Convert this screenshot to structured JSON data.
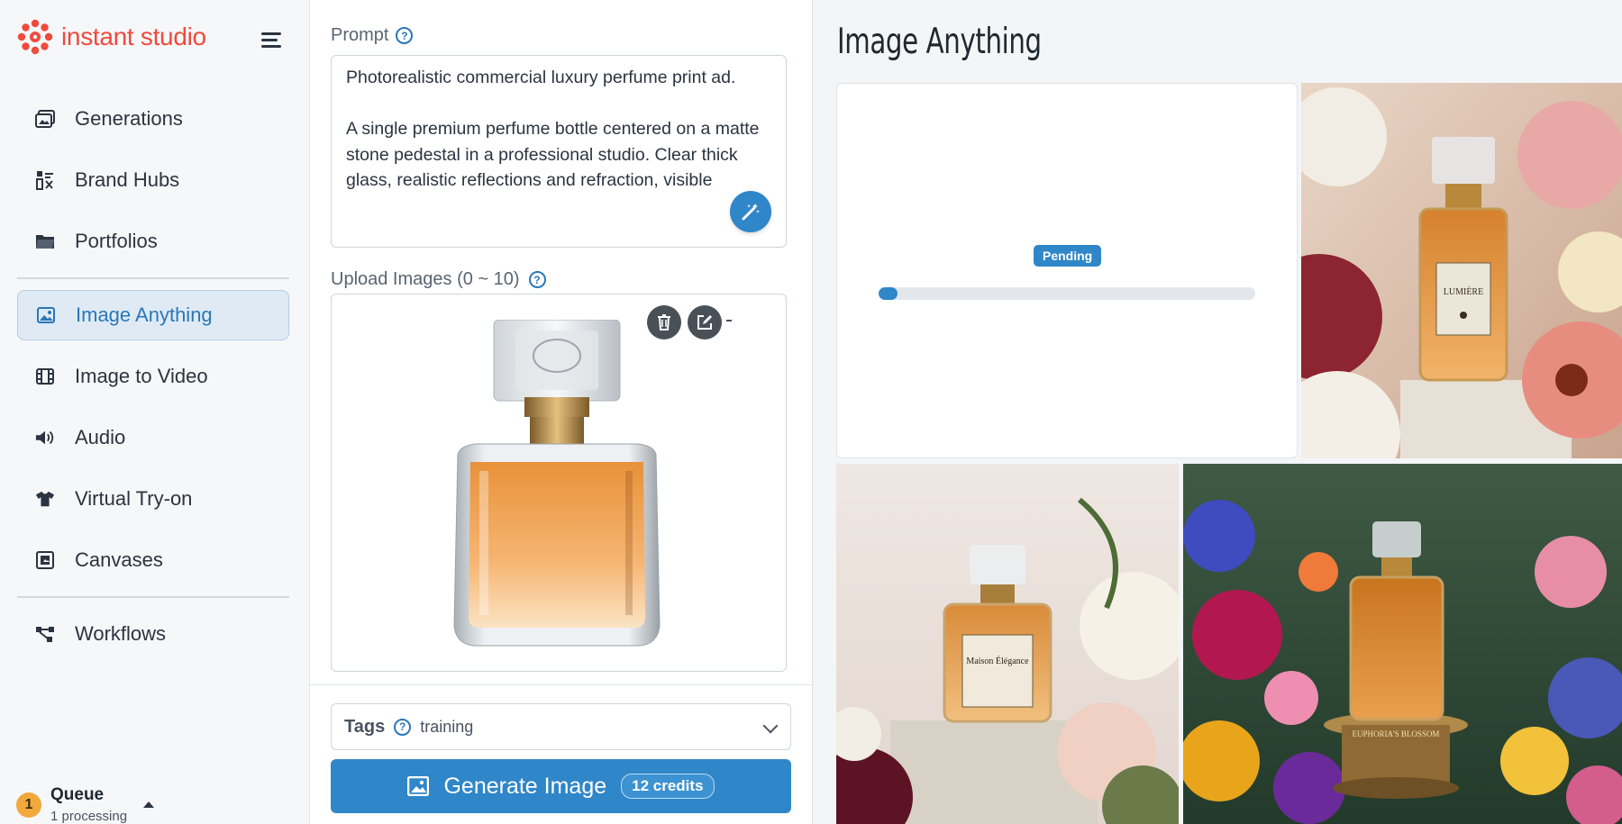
{
  "app": {
    "brand": "instant studio"
  },
  "sidebar": {
    "items": [
      {
        "label": "Generations",
        "icon": "generations-icon"
      },
      {
        "label": "Brand Hubs",
        "icon": "brand-hubs-icon"
      },
      {
        "label": "Portfolios",
        "icon": "folder-icon"
      },
      {
        "label": "Image Anything",
        "icon": "image-icon",
        "active": true
      },
      {
        "label": "Image to Video",
        "icon": "film-icon"
      },
      {
        "label": "Audio",
        "icon": "speaker-icon"
      },
      {
        "label": "Virtual Try-on",
        "icon": "shirt-icon"
      },
      {
        "label": "Canvases",
        "icon": "canvas-icon"
      },
      {
        "label": "Workflows",
        "icon": "workflow-icon"
      }
    ],
    "queue": {
      "count": "1",
      "title": "Queue",
      "subtitle": "1 processing"
    }
  },
  "form": {
    "prompt_label": "Prompt",
    "prompt_text": "Photorealistic commercial luxury perfume print ad.\n\nA single premium perfume bottle centered on a matte stone pedestal in a professional studio. Clear thick glass, realistic reflections and refraction, visible",
    "upload_label": "Upload Images (0 ~ 10)",
    "tags_label": "Tags",
    "tags_value": "training",
    "generate_label": "Generate Image",
    "credits": "12 credits"
  },
  "gallery": {
    "title": "Image Anything",
    "pending": {
      "status": "Pending",
      "progress": 0.05
    },
    "images": [
      {
        "label_text": "LUMIÈRE"
      },
      {
        "label_text": "Maison Élégance"
      },
      {
        "label_text": "EUPHORIA'S BLOSSOM"
      }
    ]
  },
  "colors": {
    "accent": "#2f86c8",
    "brand": "#ef4a3c",
    "queue_badge": "#f2a93b"
  }
}
